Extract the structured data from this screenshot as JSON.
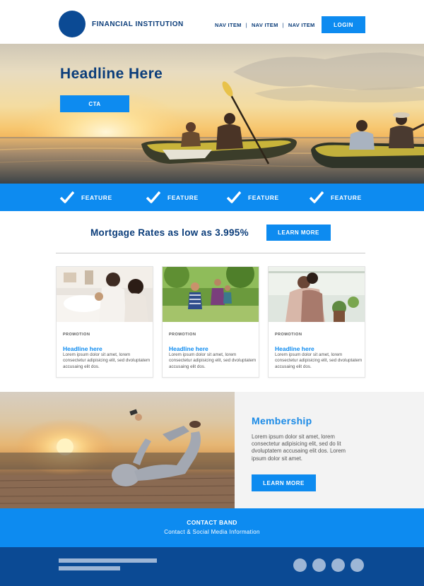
{
  "header": {
    "brand": "FINANCIAL INSTITUTION",
    "nav": [
      "NAV ITEM",
      "NAV ITEM",
      "NAV ITEM"
    ],
    "nav_separator": "|",
    "login": "LOGIN"
  },
  "hero": {
    "headline": "Headline Here",
    "cta": "CTA"
  },
  "features": [
    "FEATURE",
    "FEATURE",
    "FEATURE",
    "FEATURE"
  ],
  "rates": {
    "text": "Mortgage Rates as low as 3.995%",
    "button": "LEARN MORE"
  },
  "cards": [
    {
      "promo": "PROMOTION",
      "headline": "Headline here",
      "body": "Lorem ipsum dolor sit amet, lorem consectetur adipisicing elit, sed dvoluptatem accusaing elit dos."
    },
    {
      "promo": "PROMOTION",
      "headline": "Headline here",
      "body": "Lorem ipsum dolor sit amet, lorem consectetur adipisicing elit, sed dvoluptatem accusaing elit dos."
    },
    {
      "promo": "PROMOTION",
      "headline": "Headline here",
      "body": "Lorem ipsum dolor sit amet, lorem consectetur adipisicing elit, sed dvoluptatem accusaing elit dos."
    }
  ],
  "membership": {
    "title": "Membership",
    "body": "Lorem ipsum dolor sit amet, lorem consectetur adipisicing elit, sed do lit dvoluptatem accusaing elit dos. Lorem ipsum dolor sit amet.",
    "button": "LEARN MORE"
  },
  "contact": {
    "title": "CONTACT BAND",
    "subtitle": "Contact & Social Media Information"
  },
  "colors": {
    "primary_blue": "#0d8bf0",
    "navy": "#0b3d7a",
    "footer_navy": "#0b4a94"
  }
}
